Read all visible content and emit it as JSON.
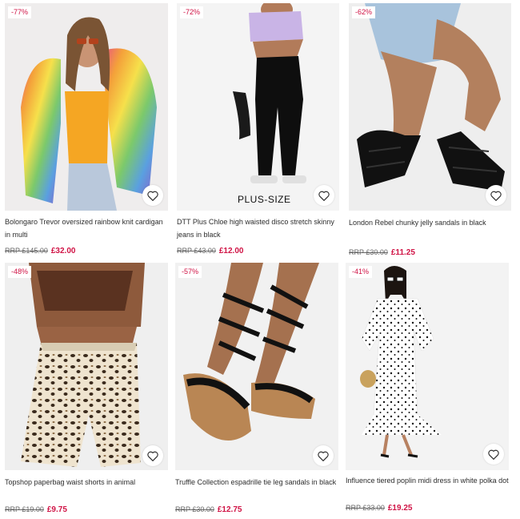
{
  "accent": "#d01345",
  "products": [
    {
      "discount": "-77%",
      "title": "Bolongaro Trevor oversized rainbow knit cardigan in multi",
      "rrp": "RRP £145.00",
      "price": "£32.00"
    },
    {
      "discount": "-72%",
      "title": "DTT Plus Chloe high waisted disco stretch skinny jeans in black",
      "rrp": "RRP £43.00",
      "price": "£12.00",
      "tag": "PLUS-SIZE"
    },
    {
      "discount": "-62%",
      "title": "London Rebel chunky jelly sandals in black",
      "rrp": "RRP £30.00",
      "price": "£11.25"
    },
    {
      "discount": "-48%",
      "title": "Topshop paperbag waist shorts in animal",
      "rrp": "RRP £19.00",
      "price": "£9.75"
    },
    {
      "discount": "-57%",
      "title": "Truffle Collection espadrille tie leg sandals in black",
      "rrp": "RRP £30.00",
      "price": "£12.75"
    },
    {
      "discount": "-41%",
      "title": "Influence tiered poplin midi dress in white polka dot",
      "rrp": "RRP £33.00",
      "price": "£19.25"
    }
  ]
}
